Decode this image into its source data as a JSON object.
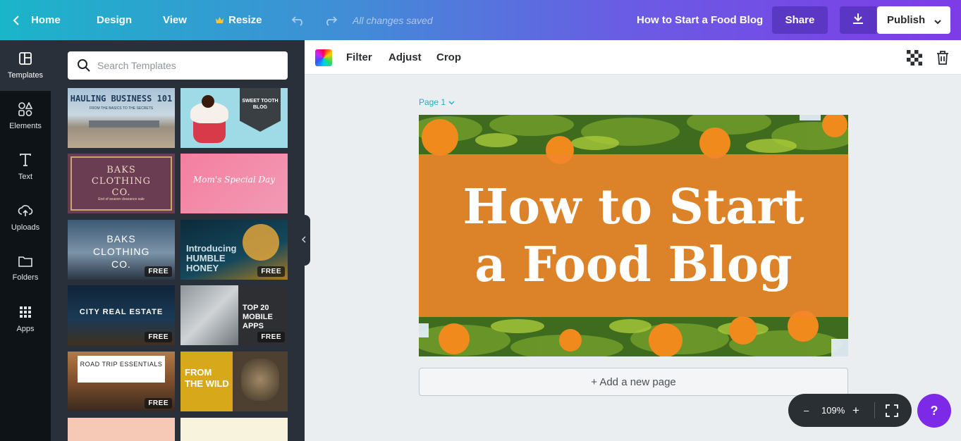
{
  "topbar": {
    "home_label": "Home",
    "design_label": "Design",
    "view_label": "View",
    "resize_label": "Resize",
    "saved_status": "All changes saved",
    "doc_title": "How to Start a Food Blog",
    "share_label": "Share",
    "publish_label": "Publish"
  },
  "rail": {
    "templates": "Templates",
    "elements": "Elements",
    "text": "Text",
    "uploads": "Uploads",
    "folders": "Folders",
    "apps": "Apps"
  },
  "search": {
    "placeholder": "Search Templates"
  },
  "templates": [
    {
      "title": "HAULING BUSINESS 101",
      "subtitle": "FROM THE BASICS TO THE SECRETS",
      "free": false
    },
    {
      "title": "SWEET TOOTH BLOG",
      "free": false
    },
    {
      "title": "BAKS CLOTHING CO.",
      "subtitle": "End of season clearance sale",
      "free": false
    },
    {
      "title": "Mom's Special Day",
      "free": false
    },
    {
      "title": "BAKS CLOTHING CO.",
      "free": true
    },
    {
      "title": "Introducing HUMBLE HONEY",
      "free": true
    },
    {
      "title": "CITY REAL ESTATE",
      "free": true
    },
    {
      "title": "TOP 20 MOBILE APPS",
      "free": true
    },
    {
      "title": "ROAD TRIP ESSENTIALS",
      "free": true
    },
    {
      "title": "FROM THE WILD",
      "free": false
    }
  ],
  "free_label": "FREE",
  "editbar": {
    "filter": "Filter",
    "adjust": "Adjust",
    "crop": "Crop"
  },
  "canvas": {
    "page_label": "Page 1",
    "design_title": "How to Start a Food Blog",
    "add_page": "+ Add a new page"
  },
  "zoom": {
    "minus": "–",
    "level": "109%",
    "plus": "+"
  },
  "help_label": "?",
  "colors": {
    "accent_teal": "#1cb2c4",
    "accent_purple": "#7d2ae8",
    "band_orange": "#f2852b"
  }
}
